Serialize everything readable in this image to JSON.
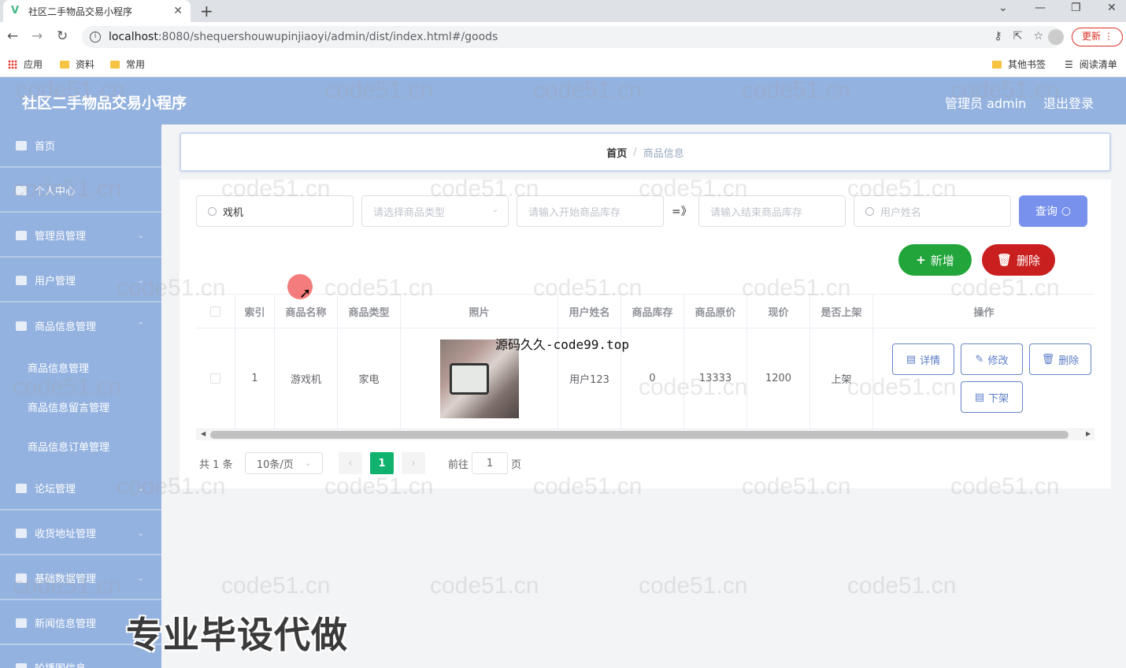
{
  "browser": {
    "tab_title": "社区二手物品交易小程序",
    "tab_close": "✕",
    "new_tab": "+",
    "url_host": "localhost",
    "url_path": ":8080/shequershouwupinjiaoyi/admin/dist/index.html#/goods",
    "update_label": "更新",
    "bookmarks": [
      "应用",
      "资料",
      "常用"
    ],
    "bookmarks_right": [
      "其他书签",
      "阅读清单"
    ]
  },
  "header": {
    "title": "社区二手物品交易小程序",
    "admin": "管理员 admin",
    "logout": "退出登录"
  },
  "sidebar": {
    "items": [
      {
        "label": "首页"
      },
      {
        "label": "个人中心"
      },
      {
        "label": "管理员管理"
      },
      {
        "label": "用户管理"
      },
      {
        "label": "商品信息管理"
      },
      {
        "label": "论坛管理"
      },
      {
        "label": "收货地址管理"
      },
      {
        "label": "基础数据管理"
      },
      {
        "label": "新闻信息管理"
      },
      {
        "label": "轮播图信息"
      }
    ],
    "subitems": [
      "商品信息管理",
      "商品信息留言管理",
      "商品信息订单管理"
    ]
  },
  "breadcrumb": {
    "home": "首页",
    "sep": "/",
    "current": "商品信息"
  },
  "search": {
    "name_value": "戏机",
    "type_placeholder": "请选择商品类型",
    "stock_start_placeholder": "请输入开始商品库存",
    "approx": "=》",
    "stock_end_placeholder": "请输入结束商品库存",
    "user_placeholder": "用户姓名",
    "query_label": "查询"
  },
  "actions": {
    "add_label": "新增",
    "delete_label": "删除"
  },
  "table": {
    "headers": [
      "索引",
      "商品名称",
      "商品类型",
      "照片",
      "用户姓名",
      "商品库存",
      "商品原价",
      "现价",
      "是否上架",
      "操作"
    ],
    "rows": [
      {
        "index": "1",
        "name": "游戏机",
        "type": "家电",
        "user": "用户123",
        "stock": "0",
        "orig_price": "13333",
        "price": "1200",
        "on_shelf": "上架"
      }
    ],
    "op_buttons": [
      "详情",
      "修改",
      "删除",
      "下架"
    ]
  },
  "pagination": {
    "total": "共 1 条",
    "page_size": "10条/页",
    "current_page": "1",
    "goto_label": "前往",
    "goto_value": "1",
    "page_unit": "页"
  },
  "overlay": {
    "image_watermark": "源码久久-code99.top",
    "promo": "专业毕设代做",
    "watermark": "code51.cn"
  },
  "colors": {
    "header_bg": "#94b2e0",
    "query_btn": "#7791ec",
    "add_btn": "#22a53b",
    "delete_btn": "#c9201f",
    "page_active": "#10b26e"
  }
}
